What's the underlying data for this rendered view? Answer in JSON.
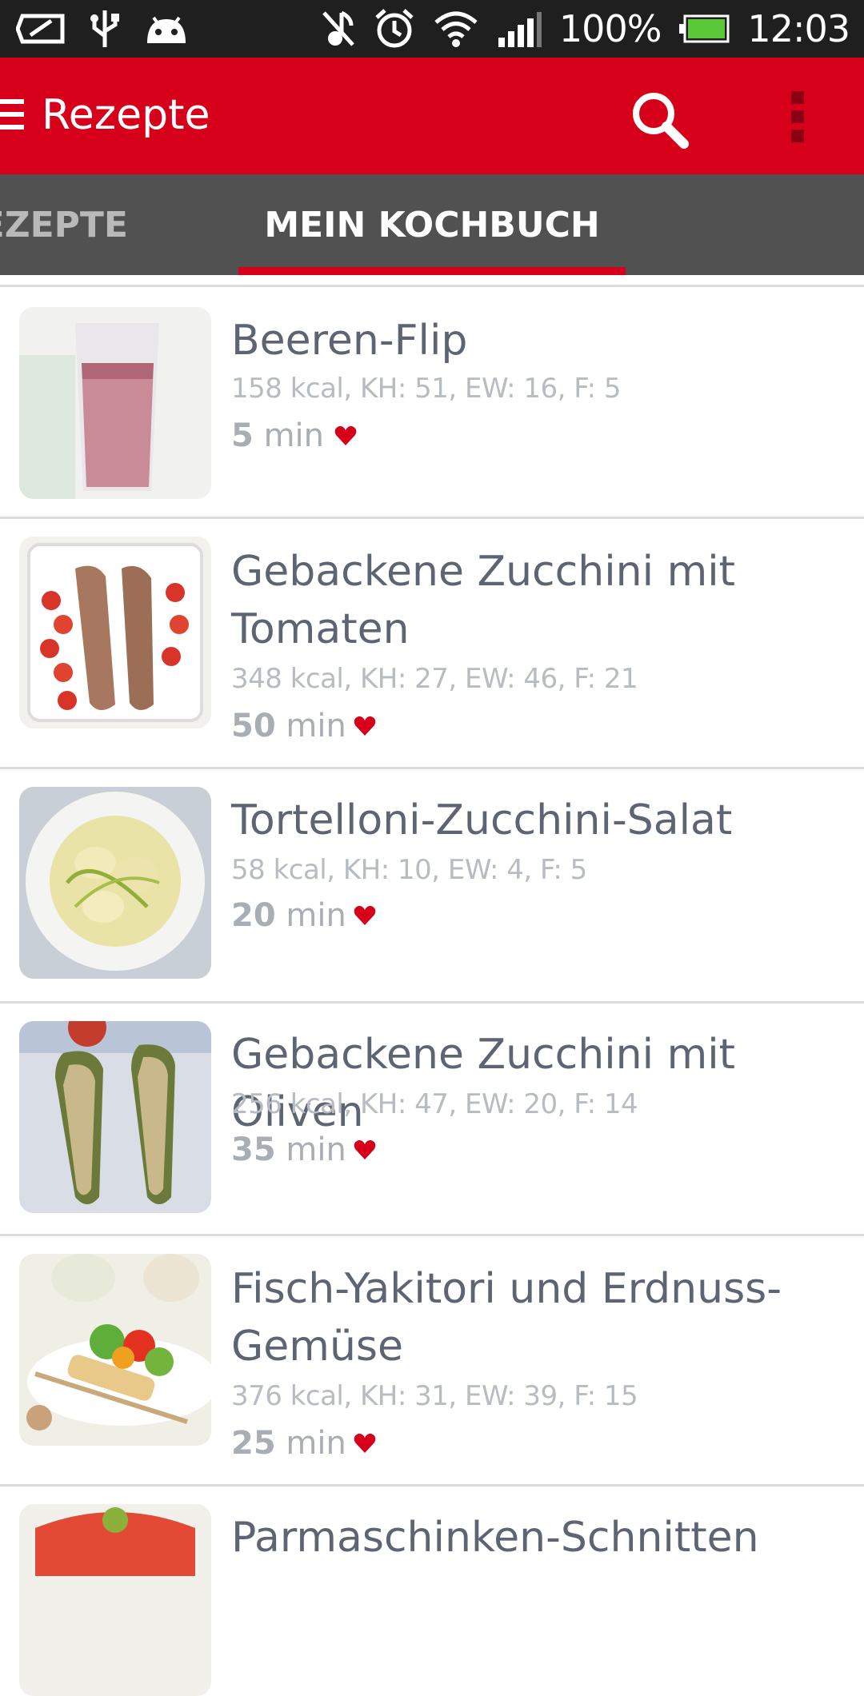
{
  "status_bar": {
    "battery_percent": "100%",
    "time": "12:03",
    "icons": [
      "notification-icon",
      "usb-icon",
      "android-icon",
      "mute-icon",
      "alarm-icon",
      "wifi-icon",
      "signal-icon",
      "battery-icon"
    ]
  },
  "app_bar": {
    "title": "Rezepte",
    "color": "#d7001a",
    "icons": [
      "menu-icon",
      "search-icon",
      "overflow-icon"
    ]
  },
  "tabs": [
    {
      "label": "REZEPTE",
      "visible_text": "EZEPTE",
      "selected": false
    },
    {
      "label": "MEIN KOCHBUCH",
      "selected": true
    }
  ],
  "recipes": [
    {
      "title": "Beeren-Flip",
      "nutrition": "158 kcal, KH: 51, EW: 16, F: 5",
      "time_value": "5",
      "time_unit": "min",
      "favorite": true
    },
    {
      "title": "Gebackene Zucchini mit Tomaten",
      "nutrition": "348 kcal, KH: 27, EW: 46, F: 21",
      "time_value": "50",
      "time_unit": "min",
      "favorite": true
    },
    {
      "title": "Tortelloni-Zucchini-Salat",
      "nutrition": "58 kcal, KH: 10, EW: 4, F: 5",
      "time_value": "20",
      "time_unit": "min",
      "favorite": true
    },
    {
      "title": "Gebackene Zucchini mit Oliven",
      "nutrition": "256 kcal, KH: 47, EW: 20, F: 14",
      "time_value": "35",
      "time_unit": "min",
      "favorite": true
    },
    {
      "title": "Fisch-Yakitori und Erdnuss-Gemüse",
      "nutrition": "376 kcal, KH: 31, EW: 39, F: 15",
      "time_value": "25",
      "time_unit": "min",
      "favorite": true
    },
    {
      "title": "Parmaschinken-Schnitten"
    }
  ]
}
